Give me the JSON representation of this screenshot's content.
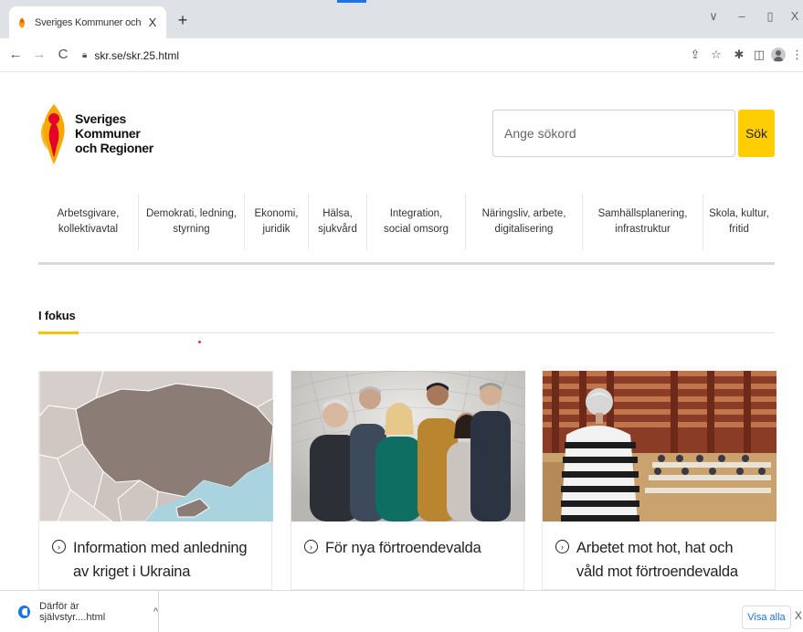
{
  "browser": {
    "tab_title": "Sveriges Kommuner och Regione",
    "tab_close": "X",
    "new_tab": "+",
    "url": "skr.se/skr.25.html",
    "controls": {
      "dropdown": "∨",
      "minimize": "–",
      "restore": "▯",
      "close": "X"
    }
  },
  "site": {
    "logo_lines": [
      "Sveriges",
      "Kommuner",
      "och Regioner"
    ],
    "search_placeholder": "Ange sökord",
    "search_button": "Sök",
    "nav": [
      {
        "line1": "Arbetsgivare,",
        "line2": "kollektivavtal"
      },
      {
        "line1": "Demokrati, ledning,",
        "line2": "styrning"
      },
      {
        "line1": "Ekonomi,",
        "line2": "juridik"
      },
      {
        "line1": "Hälsa,",
        "line2": "sjukvård"
      },
      {
        "line1": "Integration,",
        "line2": "social omsorg"
      },
      {
        "line1": "Näringsliv, arbete,",
        "line2": "digitalisering"
      },
      {
        "line1": "Samhällsplanering,",
        "line2": "infrastruktur"
      },
      {
        "line1": "Skola, kultur,",
        "line2": "fritid"
      }
    ],
    "focus_heading": "I fokus",
    "cards": [
      {
        "title": "Information med anledning av kriget i Ukraina",
        "image": "ukraine-map"
      },
      {
        "title": "För nya förtroendevalda",
        "image": "group-photo"
      },
      {
        "title": "Arbetet mot hot, hat och våld mot förtroendevalda",
        "image": "assembly-hall"
      }
    ]
  },
  "downloads": {
    "file_name": "Därför är självstyr....html",
    "caret": "^",
    "show_all": "Visa alla",
    "close": "X"
  },
  "colors": {
    "accent_yellow": "#ffce00",
    "focus_underline": "#f5c400",
    "chrome_tabbar": "#dee1e6",
    "link_blue": "#1a73e8"
  }
}
